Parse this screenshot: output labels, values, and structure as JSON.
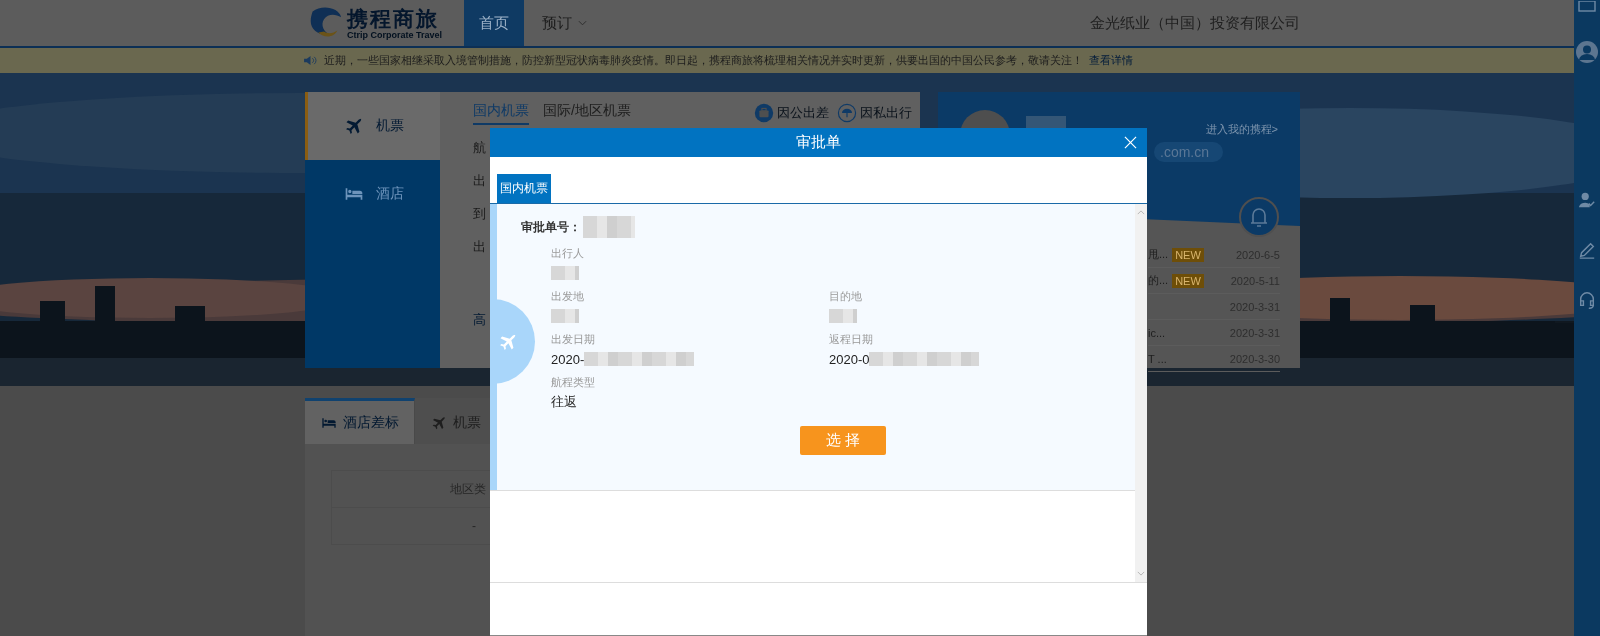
{
  "header": {
    "logo": {
      "name": "携程商旅",
      "tagline": "Ctrip Corporate Travel"
    },
    "nav": [
      {
        "label": "首页",
        "selected": true
      },
      {
        "label": "预订",
        "selected": false,
        "dropdown": true
      }
    ],
    "company": "金光纸业（中国）投资有限公司"
  },
  "notice": {
    "text": "近期，一些国家相继采取入境管制措施，防控新型冠状病毒肺炎疫情。即日起，携程商旅将梳理相关情况并实时更新，供要出国的中国公民参考，敬请关注！",
    "link": "查看详情"
  },
  "booking": {
    "categories": [
      {
        "label": "机票",
        "selected": true
      },
      {
        "label": "酒店",
        "selected": false
      }
    ],
    "tabs": [
      {
        "label": "国内机票",
        "selected": true
      },
      {
        "label": "国际/地区机票",
        "selected": false
      }
    ],
    "trip_types": [
      {
        "label": "因公出差"
      },
      {
        "label": "因私出行"
      }
    ],
    "field_labels": [
      "航",
      "出",
      "到",
      "出",
      "高"
    ]
  },
  "user_card": {
    "email": ".com.cn",
    "trips_link": "进入我的携程>",
    "news": [
      {
        "title": "甩...",
        "badge": "NEW",
        "date": "2020-6-5"
      },
      {
        "title": "的...",
        "badge": "NEW",
        "date": "2020-5-11"
      },
      {
        "date": "2020-3-31"
      },
      {
        "title": "ic...",
        "date": "2020-3-31"
      },
      {
        "title": "T ...",
        "date": "2020-3-30"
      }
    ]
  },
  "standards": {
    "tabs": [
      {
        "label": "酒店差标",
        "selected": true
      },
      {
        "label": "机票",
        "selected": false
      }
    ],
    "table": {
      "columns": [
        "地区类"
      ],
      "rows": [
        [
          "-"
        ]
      ]
    }
  },
  "modal": {
    "title": "审批单",
    "tabs": [
      {
        "label": "国内机票",
        "selected": true
      }
    ],
    "number_label": "审批单号：",
    "rows": [
      [
        {
          "label": "出行人",
          "redacted": true
        }
      ],
      [
        {
          "label": "出发地",
          "redacted": true
        },
        {
          "label": "目的地",
          "redacted": true
        }
      ],
      [
        {
          "label": "出发日期",
          "value": "2020-",
          "redacted": true
        },
        {
          "label": "返程日期",
          "value": "2020-0",
          "redacted": true
        }
      ],
      [
        {
          "label": "航程类型",
          "value": "往返"
        }
      ]
    ],
    "button": "选 择"
  }
}
